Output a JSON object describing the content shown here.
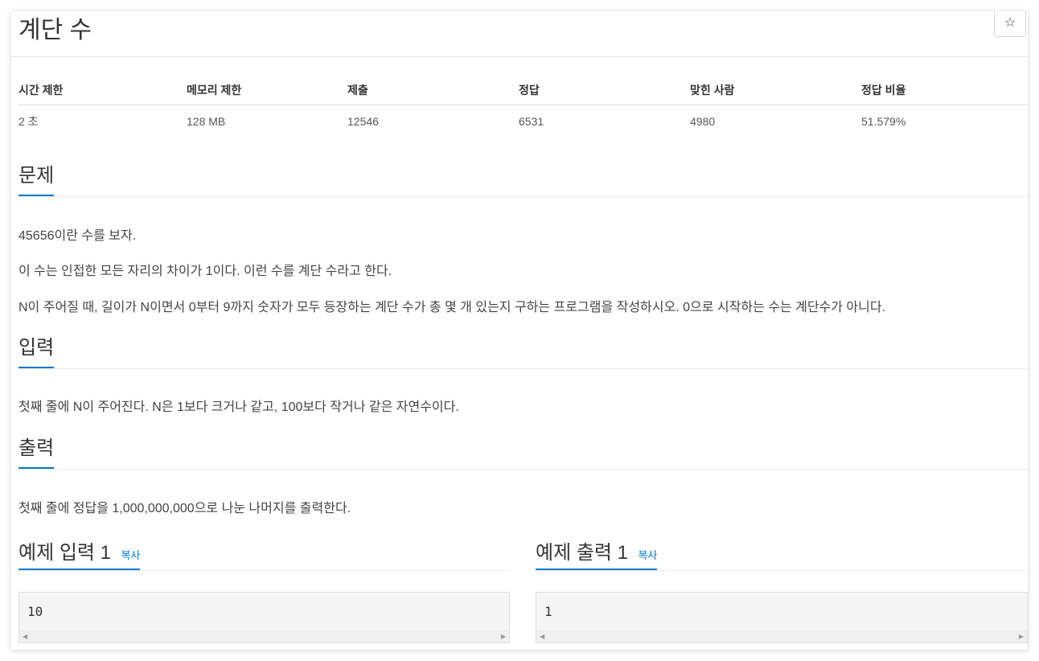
{
  "problem": {
    "title": "계단 수",
    "star_icon": "☆"
  },
  "info_table": {
    "headers": [
      "시간 제한",
      "메모리 제한",
      "제출",
      "정답",
      "맞힌 사람",
      "정답 비율"
    ],
    "values": [
      "2 초",
      "128 MB",
      "12546",
      "6531",
      "4980",
      "51.579%"
    ]
  },
  "sections": {
    "description": {
      "heading": "문제",
      "paragraphs": [
        "45656이란 수를 보자.",
        "이 수는 인접한 모든 자리의 차이가 1이다. 이런 수를 계단 수라고 한다.",
        "N이 주어질 때, 길이가 N이면서 0부터 9까지 숫자가 모두 등장하는 계단 수가 총 몇 개 있는지 구하는 프로그램을 작성하시오. 0으로 시작하는 수는 계단수가 아니다."
      ]
    },
    "input": {
      "heading": "입력",
      "text": "첫째 줄에 N이 주어진다. N은 1보다 크거나 같고, 100보다 작거나 같은 자연수이다."
    },
    "output": {
      "heading": "출력",
      "text": "첫째 줄에 정답을 1,000,000,000으로 나눈 나머지를 출력한다."
    }
  },
  "samples": {
    "input": {
      "title": "예제 입력 1",
      "copy": "복사",
      "content": "10"
    },
    "output": {
      "title": "예제 출력 1",
      "copy": "복사",
      "content": "1"
    }
  },
  "colors": {
    "accent": "#0078c8"
  },
  "icons": {
    "star": "star-icon",
    "scroll_left": "scroll-left-icon",
    "scroll_right": "scroll-right-icon"
  }
}
